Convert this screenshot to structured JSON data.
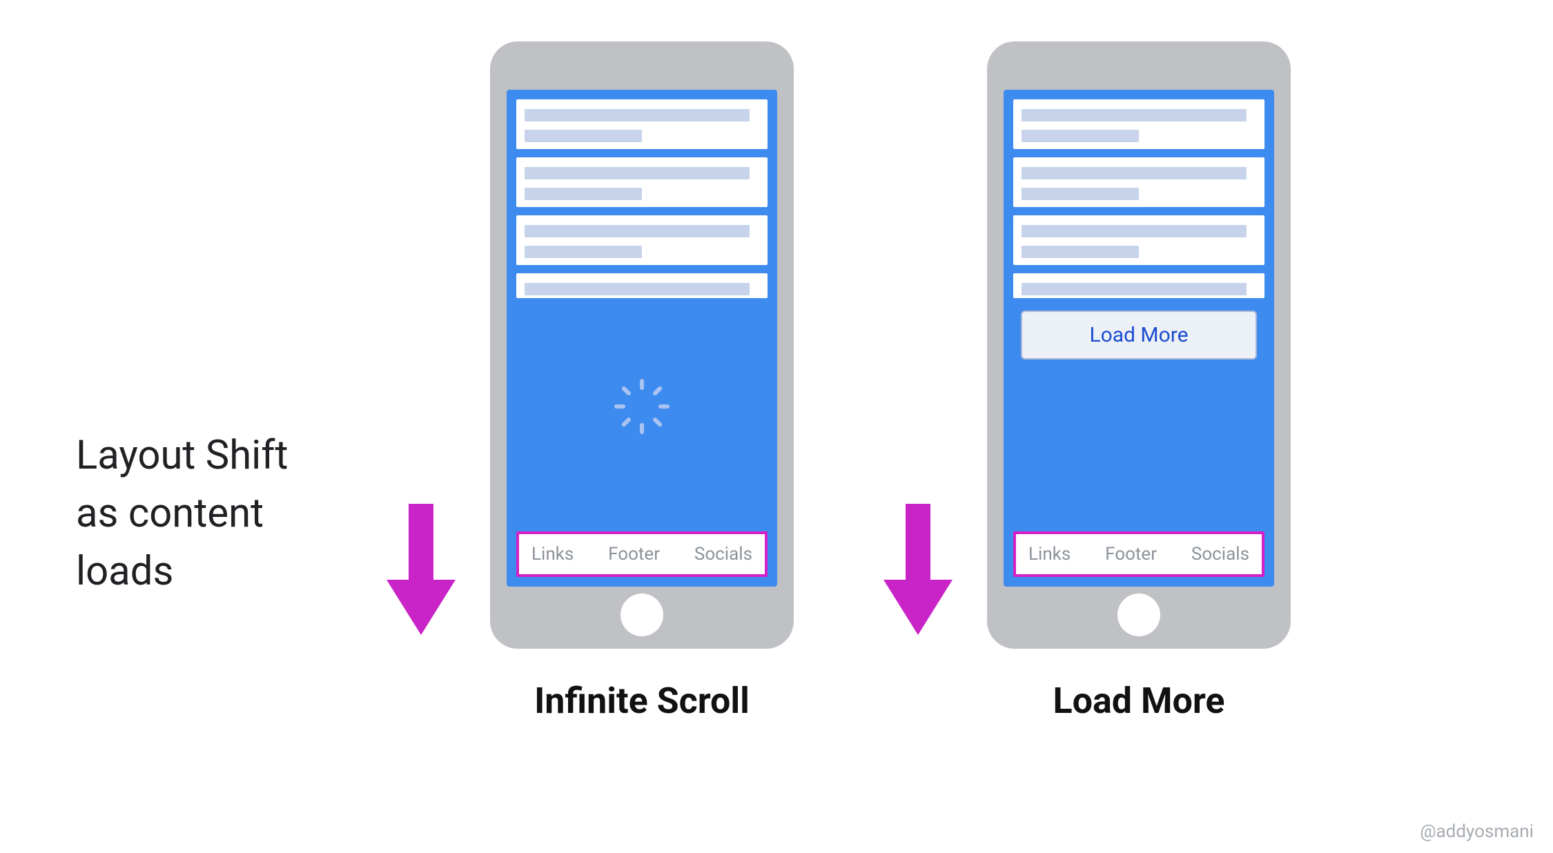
{
  "caption": "Layout Shift\nas content\nloads",
  "labels": {
    "infinite": "Infinite Scroll",
    "loadmore": "Load More"
  },
  "loadmore_button": "Load More",
  "footer_links": {
    "a": "Links",
    "b": "Footer",
    "c": "Socials"
  },
  "credit": "@addyosmani",
  "colors": {
    "accent": "#3e8bf0",
    "highlight": "#d61fc6",
    "arrow": "#c924c8"
  }
}
